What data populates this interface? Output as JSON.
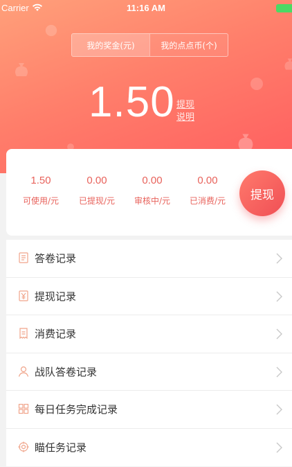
{
  "status_bar": {
    "carrier": "Carrier",
    "time": "11:16 AM"
  },
  "segment": {
    "active_label": "我的奖金(元)",
    "inactive_label": "我的点点币(个)"
  },
  "balance": {
    "amount": "1.50",
    "link1": "提现",
    "link2": "说明"
  },
  "stats": [
    {
      "value": "1.50",
      "label": "可使用/元"
    },
    {
      "value": "0.00",
      "label": "已提现/元"
    },
    {
      "value": "0.00",
      "label": "审核中/元"
    },
    {
      "value": "0.00",
      "label": "已消费/元"
    }
  ],
  "withdraw_button": "提现",
  "menu": [
    {
      "label": "答卷记录",
      "icon": "document-list-icon"
    },
    {
      "label": "提现记录",
      "icon": "yen-note-icon"
    },
    {
      "label": "消费记录",
      "icon": "receipt-icon"
    },
    {
      "label": "战队答卷记录",
      "icon": "person-icon"
    },
    {
      "label": "每日任务完成记录",
      "icon": "grid-icon"
    },
    {
      "label": "瞄任务记录",
      "icon": "target-icon"
    }
  ],
  "colors": {
    "accent": "#e8625b",
    "gradient_start": "#ffa07a",
    "gradient_end": "#ff5d5f"
  }
}
